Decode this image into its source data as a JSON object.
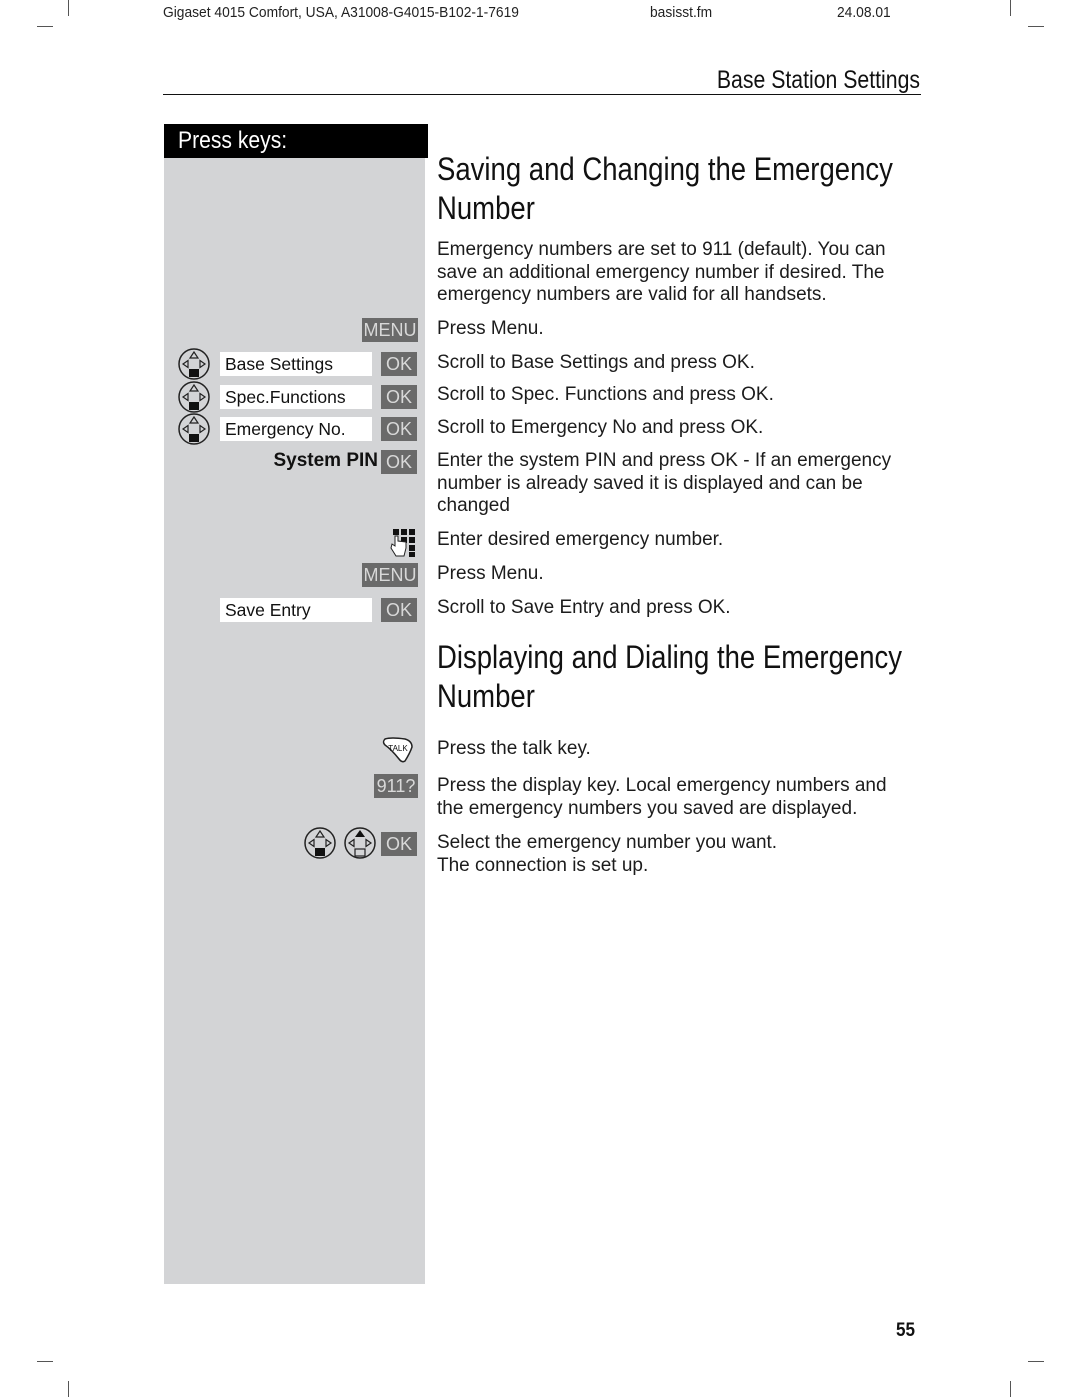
{
  "running_header": {
    "document_id": "Gigaset 4015 Comfort, USA, A31008-G4015-B102-1-7619",
    "file": "basisst.fm",
    "date": "24.08.01"
  },
  "section_title": "Base Station Settings",
  "left_column": {
    "heading": "Press keys:",
    "keys": {
      "menu": "MENU",
      "ok": "OK",
      "emergency_display_key": "911?",
      "talk": "TALK"
    },
    "display_entries": [
      "Base Settings",
      "Spec.Functions",
      "Emergency No.",
      "Save Entry"
    ],
    "system_pin_label": "System PIN",
    "icons": [
      "navigation-key-down-icon",
      "navigation-key-up-icon",
      "keypad-icon",
      "talk-key-icon"
    ]
  },
  "sections": [
    {
      "title_line1": "Saving and Changing the Emergency",
      "title_line2": "Number",
      "intro": [
        "Emergency numbers are set to 911 (default). You can",
        "save an additional emergency number if desired. The",
        "emergency numbers are valid for all handsets."
      ],
      "steps": [
        {
          "key": "MENU",
          "text": [
            "Press Menu."
          ]
        },
        {
          "key": "Base Settings OK",
          "text": [
            "Scroll to Base Settings and press OK."
          ]
        },
        {
          "key": "Spec.Functions OK",
          "text": [
            "Scroll to Spec. Functions and press OK."
          ]
        },
        {
          "key": "Emergency No. OK",
          "text": [
            "Scroll to Emergency No and press OK."
          ]
        },
        {
          "key": "System PIN OK",
          "text": [
            "Enter the system PIN and press OK - If an emergency",
            "number is already saved it is displayed and can be",
            "changed"
          ]
        },
        {
          "key": "keypad",
          "text": [
            "Enter desired emergency number."
          ]
        },
        {
          "key": "MENU",
          "text": [
            "Press Menu."
          ]
        },
        {
          "key": "Save Entry OK",
          "text": [
            "Scroll to Save Entry and press OK."
          ]
        }
      ]
    },
    {
      "title_line1": "Displaying and Dialing the Emergency",
      "title_line2": "Number",
      "steps": [
        {
          "key": "TALK",
          "text": [
            "Press the talk key."
          ]
        },
        {
          "key": "911?",
          "text": [
            "Press the display key. Local emergency numbers and",
            "the emergency numbers you saved are displayed."
          ]
        },
        {
          "key": "nav OK",
          "text": [
            "Select the emergency number you want.",
            "The connection is set up."
          ]
        }
      ]
    }
  ],
  "page_number": "55"
}
